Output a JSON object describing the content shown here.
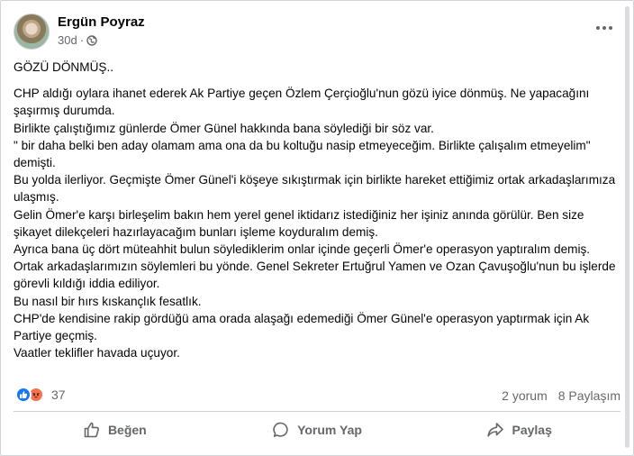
{
  "post": {
    "author": "Ergün Poyraz",
    "time": "30d",
    "audience_icon": "globe-icon",
    "heading": "GÖZÜ DÖNMÜŞ..",
    "paragraphs": [
      "CHP aldığı oylara ihanet ederek Ak Partiye geçen Özlem Çerçioğlu'nun gözü iyice dönmüş. Ne yapacağını şaşırmış durumda.",
      "Birlikte çalıştığımız günlerde Ömer Günel hakkında bana söylediği bir söz var.",
      "\" bir daha belki ben aday olamam ama ona da bu koltuğu nasip etmeyeceğim. Birlikte çalışalım etmeyelim\" demişti.",
      "Bu yolda ilerliyor. Geçmişte Ömer Günel'i köşeye sıkıştırmak için birlikte hareket ettiğimiz ortak arkadaşlarımıza ulaşmış.",
      "Gelin Ömer'e karşı birleşelim bakın hem yerel genel iktidarız istediğiniz her işiniz anında görülür. Ben size şikayet dilekçeleri hazırlayacağım bunları işleme koyduralım demiş.",
      "Ayrıca bana üç dört müteahhit bulun söylediklerim onlar içinde geçerli Ömer'e operasyon yaptıralım demiş.",
      "Ortak arkadaşlarımızın söylemleri bu yönde. Genel Sekreter Ertuğrul Yamen ve Ozan Çavuşoğlu'nun bu işlerde görevli kıldığı iddia ediliyor.",
      "Bu nasıl bir hırs kıskançlık fesatlık.",
      "CHP'de kendisine rakip gördüğü ama orada alaşağı edemediği Ömer Günel'e operasyon yaptırmak için Ak Partiye geçmiş.",
      "Vaatler teklifler havada uçuyor."
    ]
  },
  "engagement": {
    "reaction_count": "37",
    "reaction_icons": [
      "like-icon",
      "angry-icon"
    ],
    "comments": "2 yorum",
    "shares": "8 Paylaşım"
  },
  "actions": {
    "like": "Beğen",
    "comment": "Yorum Yap",
    "share": "Paylaş"
  },
  "colors": {
    "like_blue": "#1877f2",
    "angry_orange": "#f7714c",
    "secondary_text": "#65676b"
  }
}
